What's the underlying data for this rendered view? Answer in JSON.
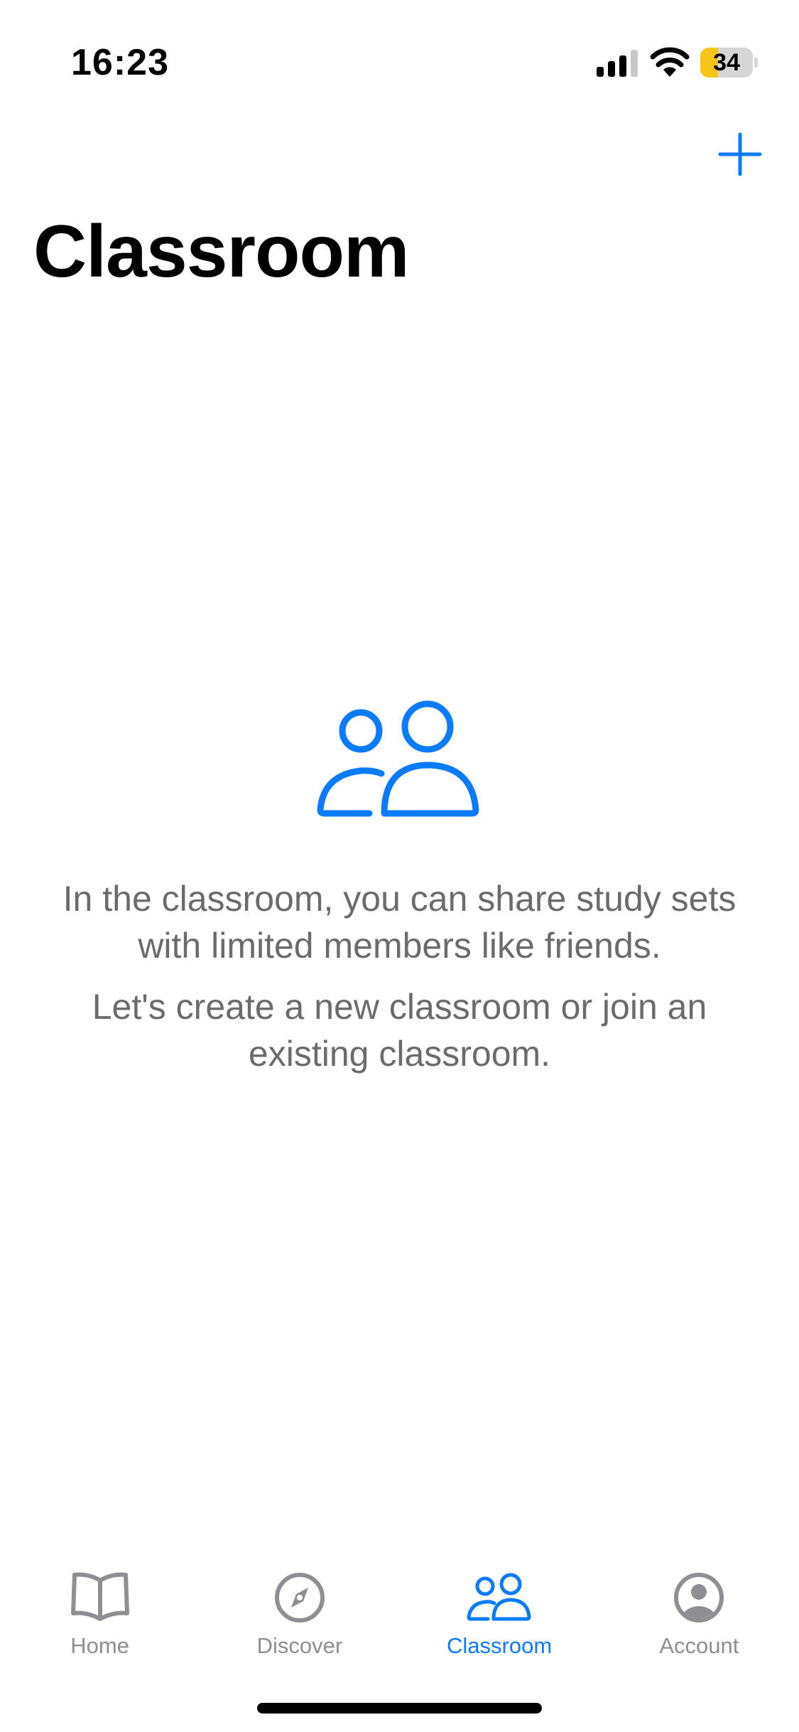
{
  "status_bar": {
    "time": "16:23",
    "battery_level": "34",
    "battery_percent": 34,
    "battery_color": "#f5c518",
    "icons": [
      "cellular-signal-icon",
      "wifi-icon",
      "battery-icon"
    ]
  },
  "nav": {
    "title": "Classroom",
    "add_icon": "plus-icon"
  },
  "empty_state": {
    "icon": "people-icon",
    "line1": "In the classroom, you can share study sets with limited members like friends.",
    "line2": "Let's create a new classroom or join an existing classroom."
  },
  "tab_bar": {
    "tabs": [
      {
        "label": "Home",
        "icon": "book-icon",
        "active": false
      },
      {
        "label": "Discover",
        "icon": "compass-icon",
        "active": false
      },
      {
        "label": "Classroom",
        "icon": "people-icon",
        "active": true
      },
      {
        "label": "Account",
        "icon": "account-icon",
        "active": false
      }
    ]
  },
  "colors": {
    "accent": "#0a7aff",
    "inactive": "#8e8e93",
    "body_text": "#6b6b6b"
  }
}
